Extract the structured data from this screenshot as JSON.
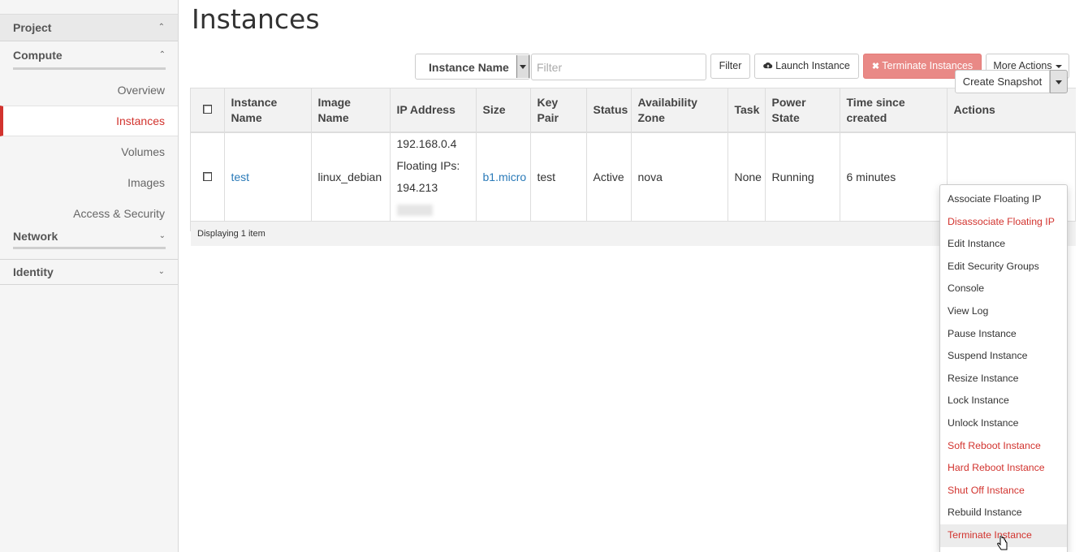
{
  "sidebar": {
    "project": "Project",
    "compute": "Compute",
    "items": [
      {
        "label": "Overview",
        "active": false
      },
      {
        "label": "Instances",
        "active": true
      },
      {
        "label": "Volumes",
        "active": false
      },
      {
        "label": "Images",
        "active": false
      },
      {
        "label": "Access & Security",
        "active": false
      }
    ],
    "network": "Network",
    "identity": "Identity"
  },
  "page": {
    "title": "Instances"
  },
  "toolbar": {
    "filter_field": "Instance Name",
    "filter_placeholder": "Filter",
    "filter_button": "Filter",
    "launch_button": "Launch Instance",
    "terminate_button": "Terminate Instances",
    "more_actions_button": "More Actions"
  },
  "table": {
    "headers": {
      "name": "Instance Name",
      "image": "Image Name",
      "ip": "IP Address",
      "size": "Size",
      "keypair": "Key Pair",
      "status": "Status",
      "zone": "Availability Zone",
      "task": "Task",
      "power": "Power State",
      "time": "Time since created",
      "actions": "Actions"
    },
    "rows": [
      {
        "name": "test",
        "image": "linux_debian",
        "ip_fixed": "192.168.0.4",
        "floating_label": "Floating IPs:",
        "ip_floating": "194.213",
        "size": "b1.micro",
        "keypair": "test",
        "status": "Active",
        "zone": "nova",
        "task": "None",
        "power": "Running",
        "time": "6 minutes",
        "action": "Create Snapshot"
      }
    ],
    "footer": "Displaying 1 item"
  },
  "actions_menu": [
    {
      "label": "Associate Floating IP",
      "danger": false
    },
    {
      "label": "Disassociate Floating IP",
      "danger": true
    },
    {
      "label": "Edit Instance",
      "danger": false
    },
    {
      "label": "Edit Security Groups",
      "danger": false
    },
    {
      "label": "Console",
      "danger": false
    },
    {
      "label": "View Log",
      "danger": false
    },
    {
      "label": "Pause Instance",
      "danger": false
    },
    {
      "label": "Suspend Instance",
      "danger": false
    },
    {
      "label": "Resize Instance",
      "danger": false
    },
    {
      "label": "Lock Instance",
      "danger": false
    },
    {
      "label": "Unlock Instance",
      "danger": false
    },
    {
      "label": "Soft Reboot Instance",
      "danger": true
    },
    {
      "label": "Hard Reboot Instance",
      "danger": true
    },
    {
      "label": "Shut Off Instance",
      "danger": true
    },
    {
      "label": "Rebuild Instance",
      "danger": false
    },
    {
      "label": "Terminate Instance",
      "danger": true,
      "hover": true
    }
  ],
  "colors": {
    "accent": "#d2332e",
    "link": "#2a7ab8",
    "terminate_bg": "#e98986",
    "sidebar_bg": "#f5f5f5"
  }
}
